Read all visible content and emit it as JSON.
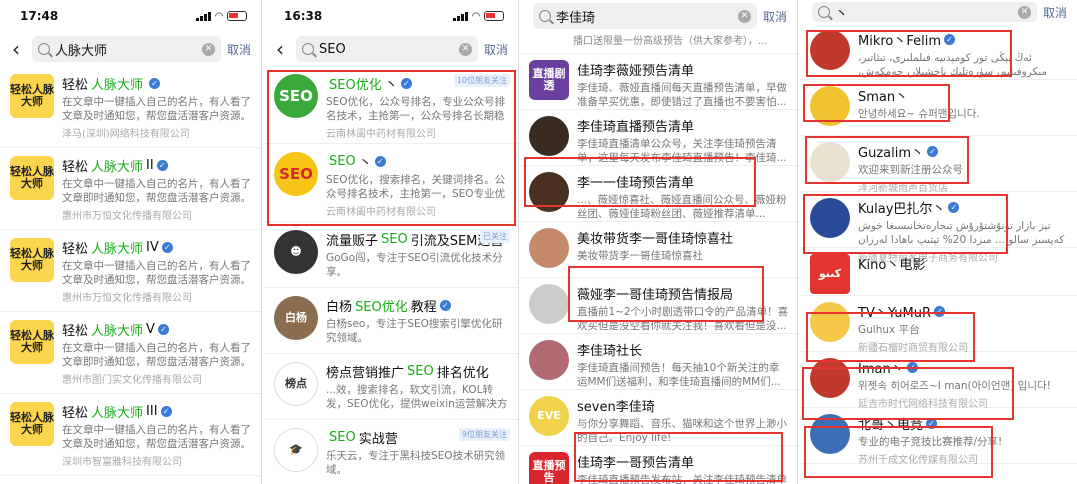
{
  "p1": {
    "time": "17:48",
    "query": "人脉大师",
    "cancel": "取消",
    "items": [
      {
        "n1": "轻松",
        "hl": "人脉大师",
        "n2": "",
        "desc": "在文章中一键插入自己的名片，有人看了文章及时通知您，帮您盘活潜客户资源。",
        "comp": "泽马(深圳)网络科技有限公司",
        "ava": "轻松人脉大师"
      },
      {
        "n1": "轻松",
        "hl": "人脉大师",
        "n2": "II",
        "desc": "在文章中一键插入自己的名片，有人看了文章即时通知您，帮您盘活潜客户资源。",
        "comp": "惠州市万恒文化传播有限公司",
        "ava": "轻松人脉大师"
      },
      {
        "n1": "轻松",
        "hl": "人脉大师",
        "n2": "IV",
        "desc": "在文章中一键插入自己的名片，有人看了文章及时通知您，帮您盘活潜客户资源。",
        "comp": "惠州市万恒文化传播有限公司",
        "ava": "轻松人脉大师"
      },
      {
        "n1": "轻松",
        "hl": "人脉大师",
        "n2": "V",
        "desc": "在文章中一键插入自己的名片，有人看了文章即时通知您，帮您盘活潜客户资源。",
        "comp": "惠州市图门实文化传播有限公司",
        "ava": "轻松人脉大师"
      },
      {
        "n1": "轻松",
        "hl": "人脉大师",
        "n2": "III",
        "desc": "在文章中一键插入自己的名片，有人看了文章及时通知您，帮您盘活潜客户资源。",
        "comp": "深圳市智富雅科技有限公司",
        "ava": "轻松人脉大师"
      }
    ]
  },
  "p2": {
    "time": "16:38",
    "query": "SEO",
    "cancel": "取消",
    "items": [
      {
        "n1": "",
        "hl": "SEO优化",
        "n2": "丶",
        "desc": "SEO优化，公众号排名，专业公众号排名技术，主抢第一，公众号排名长期稳定。",
        "comp": "云南林阖中药材有限公司",
        "tag": "10位朋友关注",
        "ava": "SEO",
        "c": "#3aa83a"
      },
      {
        "n1": "",
        "hl": "SEO",
        "n2": "丶",
        "desc": "SEO优化，搜索排名，关键词排名。公众号排名技术，主抢第一，SEO专业优化排名技术。",
        "comp": "云南林阖中药材有限公司",
        "ava": "SEO",
        "c": "#f6c516"
      },
      {
        "n1": "流量贩子",
        "hl": "SEO",
        "n2": "引流及SEM运营",
        "desc": "GoGo闯，专注于SEO引流优化技术分享。",
        "comp": "",
        "tag": "已关注",
        "ava": "☻",
        "c": "#333"
      },
      {
        "n1": "白杨",
        "hl": "SEO优化",
        "n2": "教程",
        "desc": "白杨seo，专注于SEO搜索引擎优化研究领域。",
        "comp": "",
        "ava": "白杨",
        "c": "#8a6d4e"
      },
      {
        "n1": "榜点营销推广",
        "hl": "SEO",
        "n2": "排名优化",
        "desc": "...效，搜索排名，软文引流，KOL转发，SEO优化，提供weixin运营解决方案，社群引流...",
        "comp": "",
        "ava": "榜点",
        "c": "#fff"
      },
      {
        "n1": "",
        "hl": "SEO",
        "n2": "实战营",
        "desc": "乐天云，专注于黑科技SEO技术研究领域。",
        "comp": "",
        "tag": "9位朋友关注",
        "ava": "🎓",
        "c": "#fff"
      }
    ]
  },
  "p3": {
    "query": "李佳琦",
    "cancel": "取消",
    "top": "播口送限量一份高级预告（供大家参考），...",
    "items": [
      {
        "name": "佳琦李薇娅预告清单",
        "desc": "李佳琦、薇娅直播间每天直播预告清单，早做准备早买优惠，即使错过了直播也不要害怕...",
        "ava": "直播剧透",
        "c": "#6b3fa0"
      },
      {
        "name": "李佳琦直播预告清单",
        "desc": "李佳琦直播清单公众号，关注李佳琦预告清单，这里每天发布李佳琦直播预告！李佳琦...",
        "ava": "",
        "c": "#3a2a20"
      },
      {
        "name": "李一一佳琦预告清单",
        "desc": "...、薇娅惊喜社、薇娅直播间公众号、薇娅粉丝团、薇娅佳琦粉丝团、薇娅推荐清单...",
        "ava": "",
        "c": "#4a3020"
      },
      {
        "name": "美妆带货李一哥佳琦惊喜社",
        "desc": "美妆带货李一哥佳琦惊喜社",
        "ava": "",
        "c": "#c48a6a"
      },
      {
        "name": "薇娅李一哥佳琦预告情报局",
        "desc": "直播前1~2个小时剧透带口令的产品清单！喜欢买但是没空看你就关注我！喜欢看但是没...",
        "ava": "",
        "c": "#ccc"
      },
      {
        "name": "李佳琦社长",
        "desc": "李佳琦直播间预告！每天抽10个新关注的幸运MM们送福利，和李佳琦直播间的MM们...",
        "ava": "",
        "c": "#b06a70"
      },
      {
        "name": "seven李佳琦",
        "desc": "与你分享舞蹈、音乐、猫咪和这个世界上渺小的自己。Enjoy life!",
        "ava": "EVE",
        "c": "#f2d24a"
      },
      {
        "name": "佳琦李一哥预告清单",
        "desc": "李佳琦直播预告发布站，关注李佳琦预告清单发布站！李佳琦公众号粉丝福利站，李佳琦...",
        "ava": "直播预告",
        "c": "#d9262c"
      }
    ]
  },
  "p4": {
    "query": "丶",
    "cancel": "取消",
    "items": [
      {
        "name": "Mikro丶Felim",
        "desc": "ئەڭ يېڭى تور كومېدىيە فىلملىرى، تىئاتىر، مىكروفىلىم، سۈرەتلىك ناخشىلار، جەمكەش، تېزدىن قۇشۇلۇڭ",
        "comp": "",
        "ava": "",
        "c": "#c0392b"
      },
      {
        "name": "Sman丶",
        "desc": "안녕하세요~ 슈퍼맨입니다.",
        "comp": "",
        "ava": "",
        "c": "#f2c230"
      },
      {
        "name": "Guzalim丶",
        "desc": "欢迎来到新注册公众号",
        "comp": "泽河新城雨声百货店",
        "ava": "",
        "c": "#e9e2d0"
      },
      {
        "name": "Kulay巴扎尔丶",
        "desc": "تېز بازار تونۇشتۇرۇش تىجارەتخانىسىغا خوش كەپسىز سالو ... مىزدا 20% تېتىپ باھادا لەرزان باھالىق پىلىقۇش پىلى...",
        "comp": "新疆夏特丽客电子商务有限公司",
        "ava": "",
        "c": "#2a4a9a"
      },
      {
        "name": "Kino丶电影",
        "desc": "",
        "comp": "",
        "ava": "كىنو",
        "c": "#e3342f"
      },
      {
        "name": "TV丶YuMuR",
        "desc": "Gulhux 平台",
        "comp": "新疆石榴时商贸有限公司",
        "ava": "",
        "c": "#f5c84a"
      },
      {
        "name": "Iman丶",
        "desc": "위젯속 히어로즈~I man(아이언맨) 입니다!",
        "comp": "延吉市时代网络科技有限公司",
        "ava": "",
        "c": "#c0392b"
      },
      {
        "name": "北哥丶电竞",
        "desc": "专业的电子竞技比赛推荐/分享!",
        "comp": "苏州千成文化传媒有限公司",
        "ava": "",
        "c": "#3a6fb5"
      }
    ]
  }
}
